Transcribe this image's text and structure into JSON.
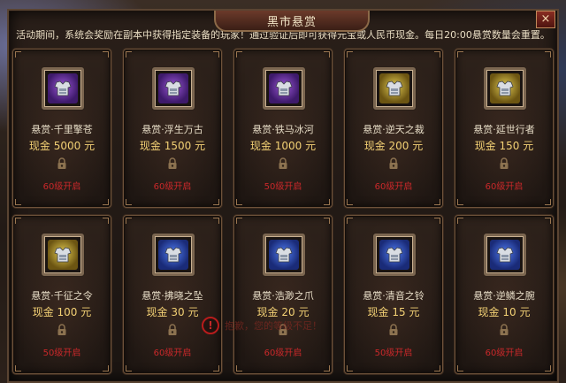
{
  "window": {
    "title": "黑市悬赏",
    "close_label": "×",
    "notice": "活动期间，系统会奖励在副本中获得指定装备的玩家！通过验证后即可获得元宝或人民币现金。每日20:00悬赏数量会重置。"
  },
  "colors": {
    "reward_text": "#f2d074",
    "locked_text": "#c9282a",
    "frame_border": "#6e523a"
  },
  "cards": [
    {
      "name": "悬赏·千里擎苍",
      "reward": "现金 5000 元",
      "requirement": "60级开启",
      "gem": "purple",
      "icon": "armor-icon"
    },
    {
      "name": "悬赏·浮生万古",
      "reward": "现金 1500 元",
      "requirement": "60级开启",
      "gem": "purple",
      "icon": "armor-icon"
    },
    {
      "name": "悬赏·铁马冰河",
      "reward": "现金 1000 元",
      "requirement": "50级开启",
      "gem": "purple",
      "icon": "armor-icon"
    },
    {
      "name": "悬赏·逆天之裁",
      "reward": "现金 200 元",
      "requirement": "60级开启",
      "gem": "yellow",
      "icon": "armor-icon"
    },
    {
      "name": "悬赏·延世行者",
      "reward": "现金 150 元",
      "requirement": "60级开启",
      "gem": "yellow",
      "icon": "armor-icon"
    },
    {
      "name": "悬赏·千征之令",
      "reward": "现金 100 元",
      "requirement": "50级开启",
      "gem": "yellow",
      "icon": "armor-icon"
    },
    {
      "name": "悬赏·拂晓之坠",
      "reward": "现金 30 元",
      "requirement": "60级开启",
      "gem": "blue",
      "icon": "armor-icon"
    },
    {
      "name": "悬赏·浩渺之爪",
      "reward": "现金 20 元",
      "requirement": "60级开启",
      "gem": "blue",
      "icon": "armor-icon"
    },
    {
      "name": "悬赏·清音之铃",
      "reward": "现金 15 元",
      "requirement": "50级开启",
      "gem": "blue",
      "icon": "armor-icon"
    },
    {
      "name": "悬赏·逆鳞之腕",
      "reward": "现金 10 元",
      "requirement": "60级开启",
      "gem": "blue",
      "icon": "armor-icon"
    }
  ],
  "toast": {
    "icon": "!",
    "text": "抱歉，您的等级不足！"
  }
}
